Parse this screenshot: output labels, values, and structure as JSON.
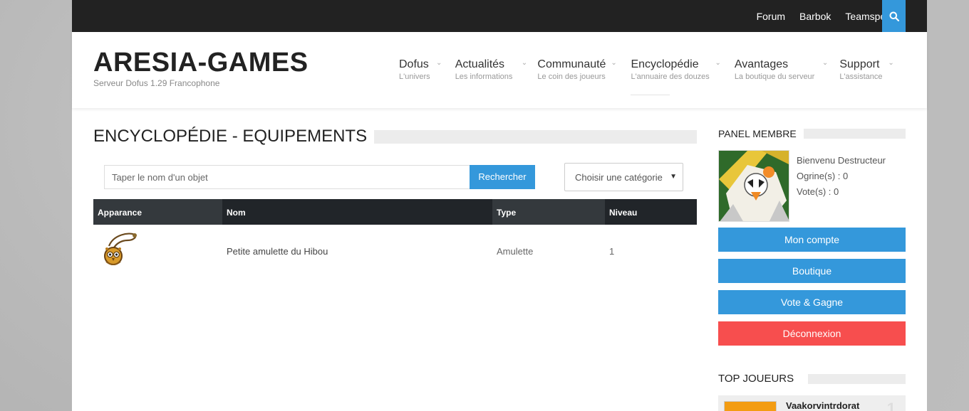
{
  "topbar": {
    "links": [
      "Forum",
      "Barbok",
      "Teamspeak"
    ]
  },
  "brand": {
    "title": "ARESIA-GAMES",
    "subtitle": "Serveur Dofus 1.29 Francophone"
  },
  "nav": {
    "items": [
      {
        "label": "Dofus",
        "desc": "L'univers"
      },
      {
        "label": "Actualités",
        "desc": "Les informations"
      },
      {
        "label": "Communauté",
        "desc": "Le coin des joueurs"
      },
      {
        "label": "Encyclopédie",
        "desc": "L'annuaire des douzes"
      },
      {
        "label": "Avantages",
        "desc": "La boutique du serveur"
      },
      {
        "label": "Support",
        "desc": "L'assistance"
      }
    ]
  },
  "main": {
    "title": "ENCYCLOPÉDIE - EQUIPEMENTS",
    "search": {
      "placeholder": "Taper le nom d'un objet",
      "button": "Rechercher"
    },
    "category": {
      "selected": "Choisir une catégorie"
    },
    "table": {
      "headers": [
        "Apparance",
        "Nom",
        "Type",
        "Niveau"
      ],
      "rows": [
        {
          "icon": "owl-amulet-icon",
          "name": "Petite amulette du Hibou",
          "type": "Amulette",
          "level": "1"
        }
      ]
    }
  },
  "sidebar": {
    "panel_title": "PANEL MEMBRE",
    "welcome": "Bienvenu Destructeur",
    "ogrines": "Ogrine(s) : 0",
    "votes": "Vote(s) : 0",
    "buttons": {
      "account": "Mon compte",
      "shop": "Boutique",
      "vote": "Vote & Gagne",
      "logout": "Déconnexion"
    },
    "top_title": "TOP JOUEURS",
    "top_players": [
      {
        "name": "Vaakorvintrdorat",
        "rank": "1"
      }
    ]
  },
  "colors": {
    "accent": "#3498db",
    "danger": "#f74e4e",
    "dark": "#222222",
    "header_cells": [
      "#34393d",
      "#212529"
    ]
  }
}
